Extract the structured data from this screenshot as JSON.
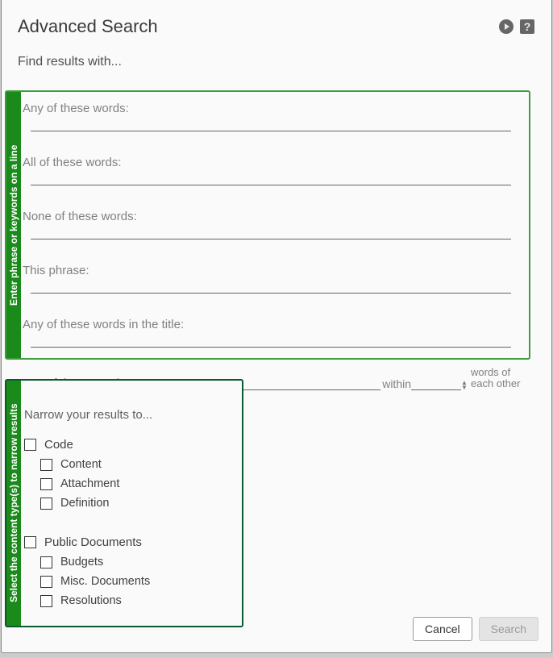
{
  "header": {
    "title": "Advanced Search",
    "subtitle": "Find results with...",
    "play_icon": "play-icon",
    "help_icon": "help-icon"
  },
  "words_panel": {
    "sidebar_label": "Enter phrase or keywords on a line",
    "fields": {
      "any": "Any of these words:",
      "all": "All of these words:",
      "none": "None of these words:",
      "phrase": "This phrase:",
      "title": "Any of these words in the title:",
      "proximity_lead": "Any of these words:",
      "within": "within",
      "trail": "words of each other"
    }
  },
  "narrow_panel": {
    "sidebar_label": "Select the content type(s) to narrow results",
    "title": "Narrow your results to...",
    "groups": [
      {
        "label": "Code",
        "children": [
          "Content",
          "Attachment",
          "Definition"
        ]
      },
      {
        "label": "Public Documents",
        "children": [
          "Budgets",
          "Misc. Documents",
          "Resolutions"
        ]
      }
    ]
  },
  "footer": {
    "cancel": "Cancel",
    "search": "Search"
  }
}
